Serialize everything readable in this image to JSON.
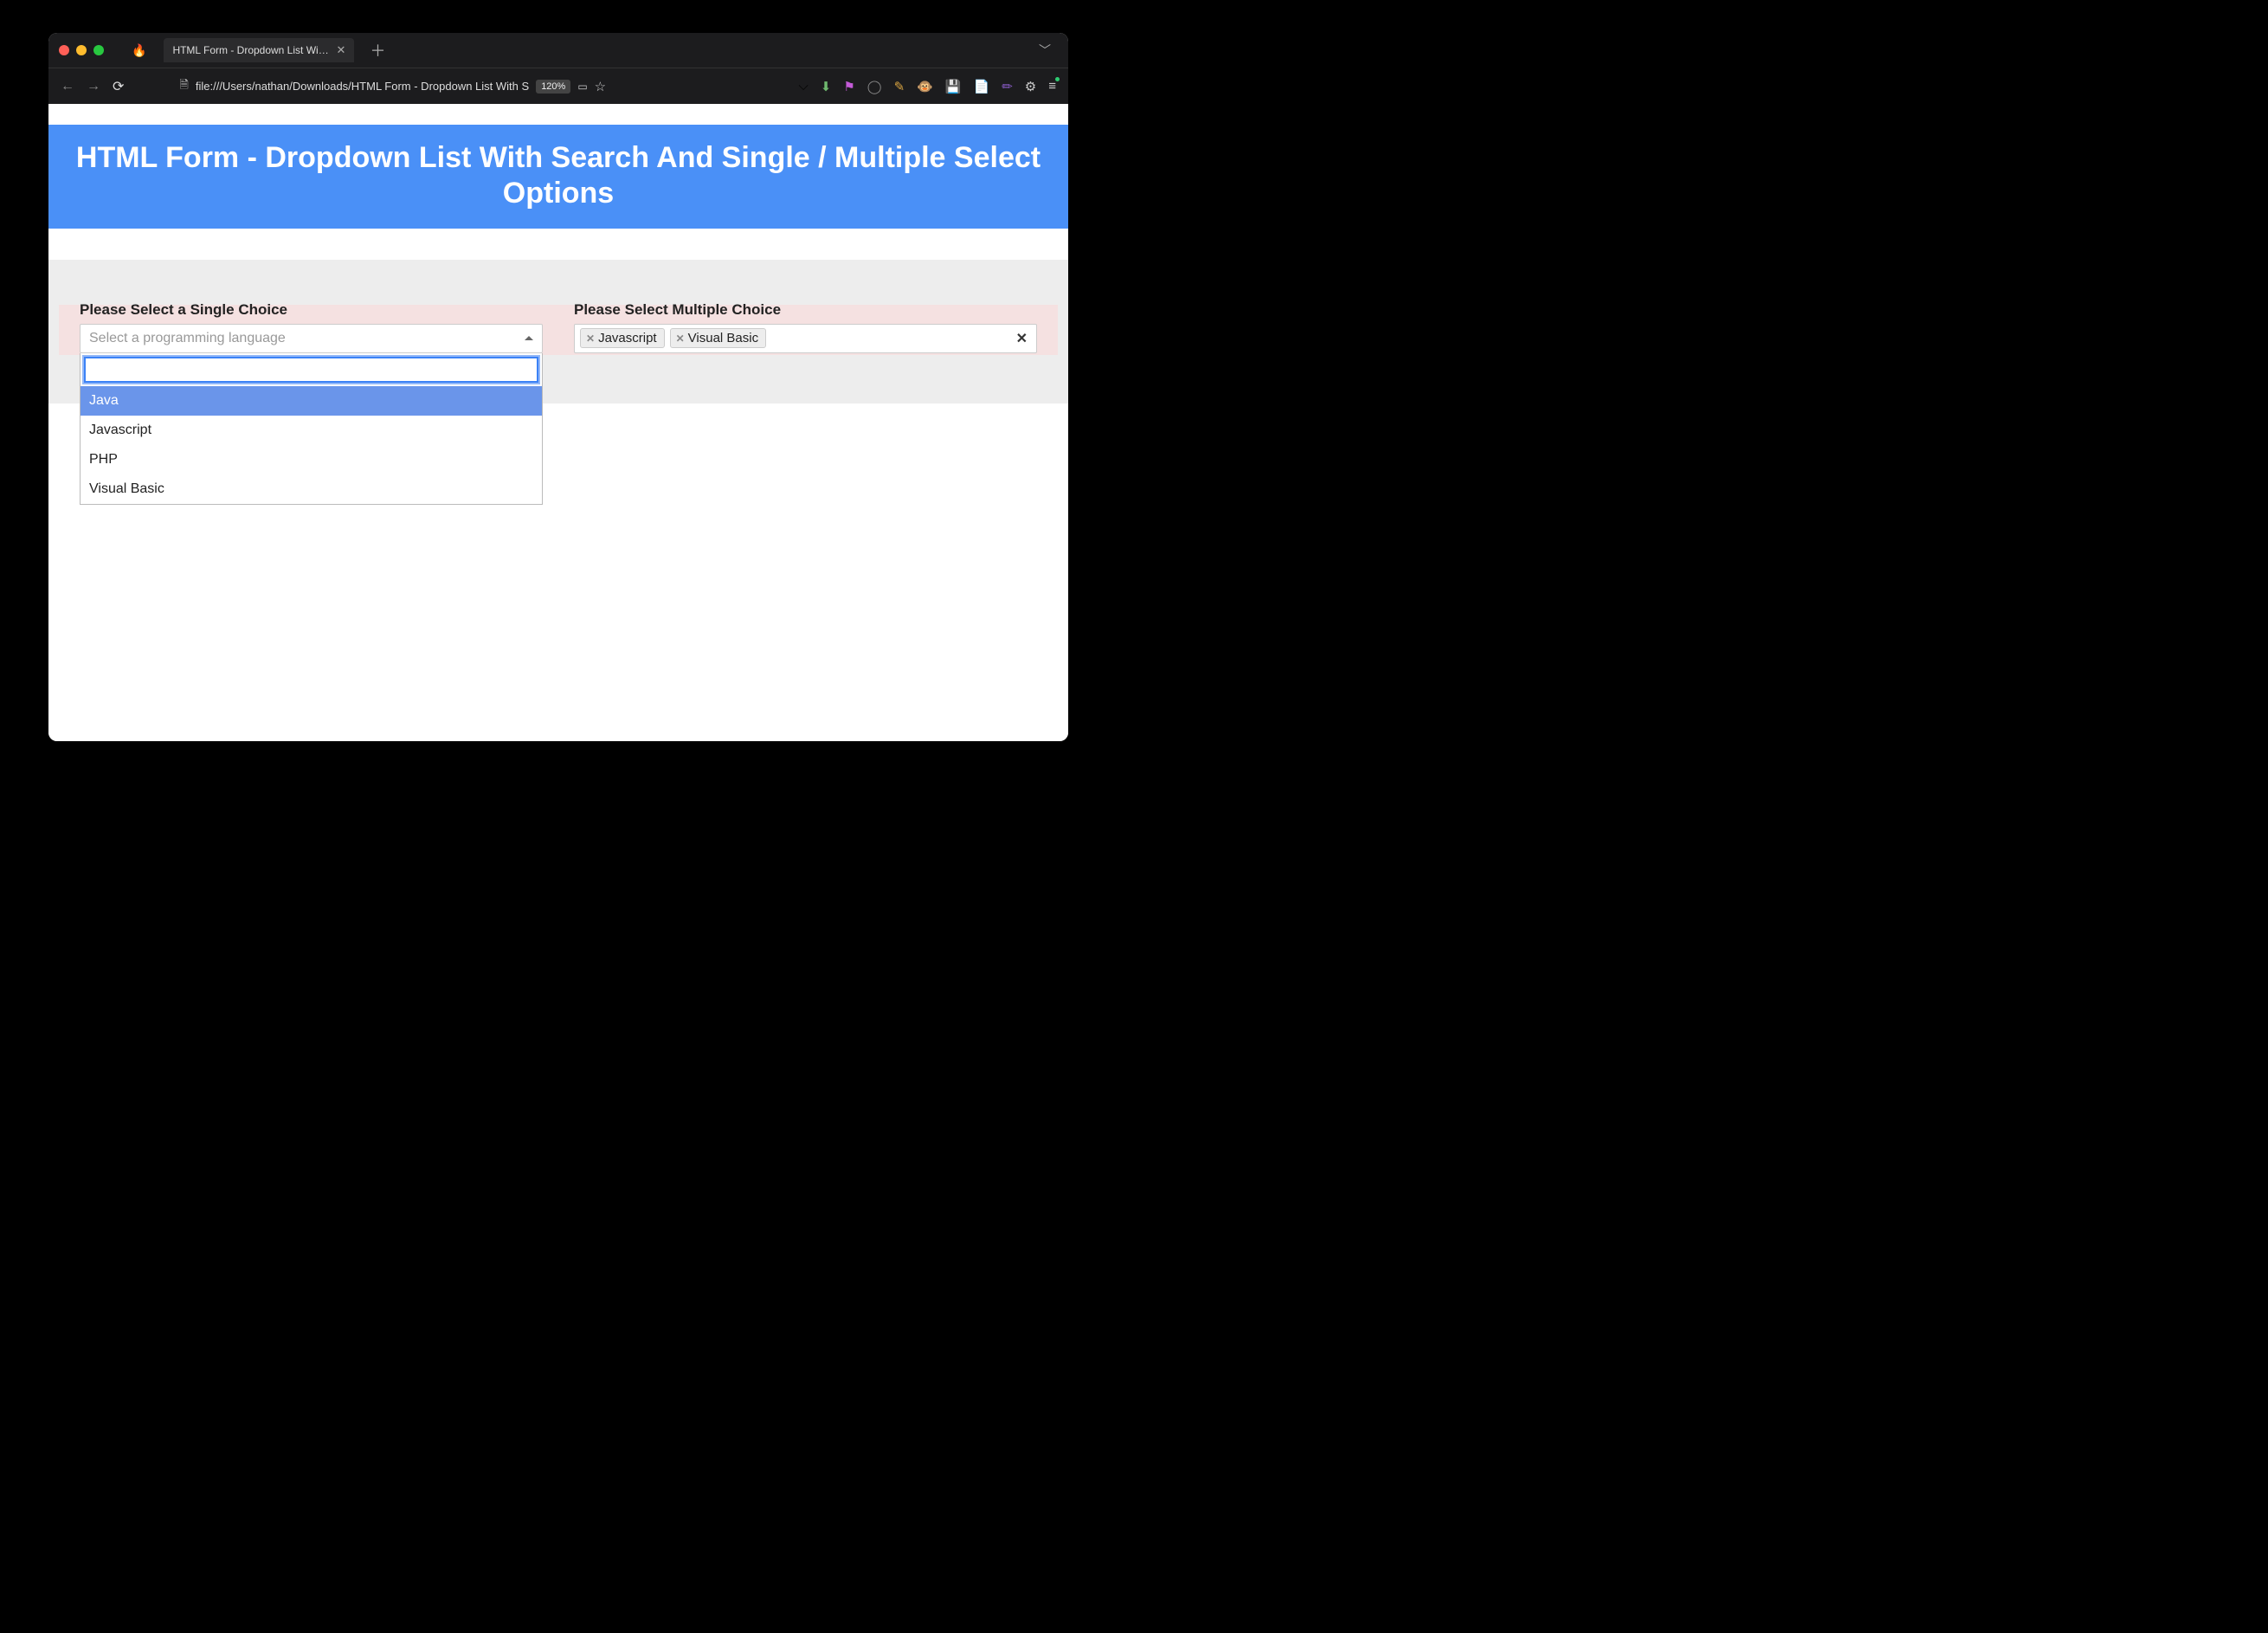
{
  "browser": {
    "tab_title": "HTML Form - Dropdown List With S",
    "url": "file:///Users/nathan/Downloads/HTML Form - Dropdown List With S",
    "zoom": "120%"
  },
  "page": {
    "heading": "HTML Form - Dropdown List With Search And Single / Multiple Select Options"
  },
  "single_select": {
    "label": "Please Select a Single Choice",
    "placeholder": "Select a programming language",
    "search_value": "",
    "options": [
      "Java",
      "Javascript",
      "PHP",
      "Visual Basic"
    ],
    "highlighted_index": 0
  },
  "multi_select": {
    "label": "Please Select Multiple Choice",
    "selected": [
      "Javascript",
      "Visual Basic"
    ]
  }
}
